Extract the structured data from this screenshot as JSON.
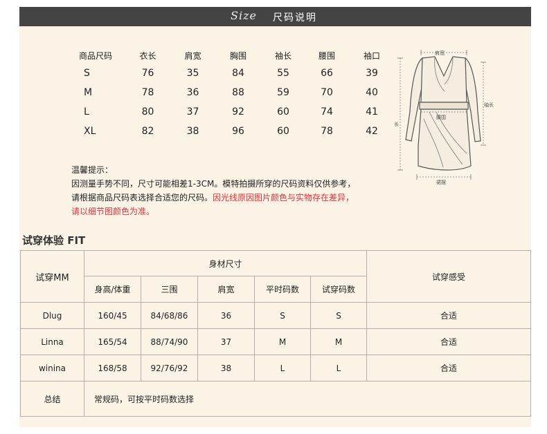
{
  "header": {
    "size_word": "Size",
    "title": "尺码说明"
  },
  "size_table": {
    "headers": [
      "商品尺码",
      "衣长",
      "肩宽",
      "胸围",
      "袖长",
      "腰围",
      "袖口"
    ],
    "rows": [
      [
        "S",
        "76",
        "35",
        "84",
        "55",
        "66",
        "39"
      ],
      [
        "M",
        "78",
        "36",
        "88",
        "59",
        "70",
        "40"
      ],
      [
        "L",
        "80",
        "37",
        "92",
        "60",
        "74",
        "41"
      ],
      [
        "XL",
        "82",
        "38",
        "96",
        "60",
        "78",
        "42"
      ]
    ]
  },
  "diagram": {
    "shoulder_label": "肩宽",
    "sleeve_label": "袖长",
    "length_label": "衣长",
    "waist_label": "腰围",
    "hem_label": "裙摆"
  },
  "notes": {
    "title": "温馨提示：",
    "line1": "因测量手势不同，尺寸可能相差1-3CM。模特拍摄所穿的尺码资料仅供参考，",
    "line2_black": "请根据商品尺码表选择合适您的尺码。",
    "line2_red": "因光线原因图片颜色与实物存在差异，",
    "line3_red": "请以细节图颜色为准。"
  },
  "fit": {
    "title": "试穿体验 FIT",
    "col_person": "试穿MM",
    "col_body": "身材尺寸",
    "col_feel": "试穿感受",
    "subheaders": [
      "身高/体重",
      "三围",
      "肩宽",
      "平时码数",
      "试穿码数"
    ],
    "rows": [
      {
        "name": "Dlug",
        "hw": "160/45",
        "bwh": "84/68/86",
        "shoulder": "36",
        "usual": "S",
        "tried": "S",
        "feel": "合适"
      },
      {
        "name": "Linna",
        "hw": "165/54",
        "bwh": "88/74/90",
        "shoulder": "37",
        "usual": "M",
        "tried": "M",
        "feel": "合适"
      },
      {
        "name": "winina",
        "hw": "168/58",
        "bwh": "92/76/92",
        "shoulder": "38",
        "usual": "L",
        "tried": "L",
        "feel": "合适"
      }
    ],
    "summary_label": "总结",
    "summary_text": "常规码，可按平时码数选择"
  }
}
